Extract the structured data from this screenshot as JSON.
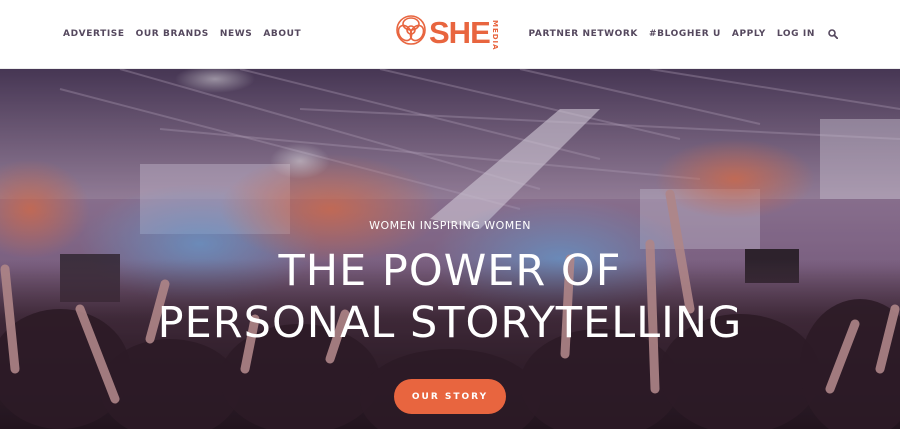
{
  "header": {
    "nav_left": [
      {
        "label": "ADVERTISE"
      },
      {
        "label": "OUR BRANDS"
      },
      {
        "label": "NEWS"
      },
      {
        "label": "ABOUT"
      }
    ],
    "nav_right": [
      {
        "label": "PARTNER NETWORK"
      },
      {
        "label": "#BLOGHER U"
      },
      {
        "label": "APPLY"
      },
      {
        "label": "LOG IN"
      }
    ],
    "search_icon": "search-icon",
    "logo": {
      "wordmark": "SHE",
      "subtext": "MEDIA",
      "icon": "floral-knot-icon",
      "color": "#e8653f"
    }
  },
  "hero": {
    "eyebrow": "WOMEN INSPIRING WOMEN",
    "headline_line1": "THE POWER OF",
    "headline_line2": "PERSONAL STORYTELLING",
    "cta_label": "OUR STORY",
    "cta_color": "#e8653f",
    "background": "photo of a crowd of women raising hands in a lit event hall"
  },
  "colors": {
    "nav_text": "#55485e",
    "accent": "#e8653f",
    "hero_text": "#ffffff"
  }
}
